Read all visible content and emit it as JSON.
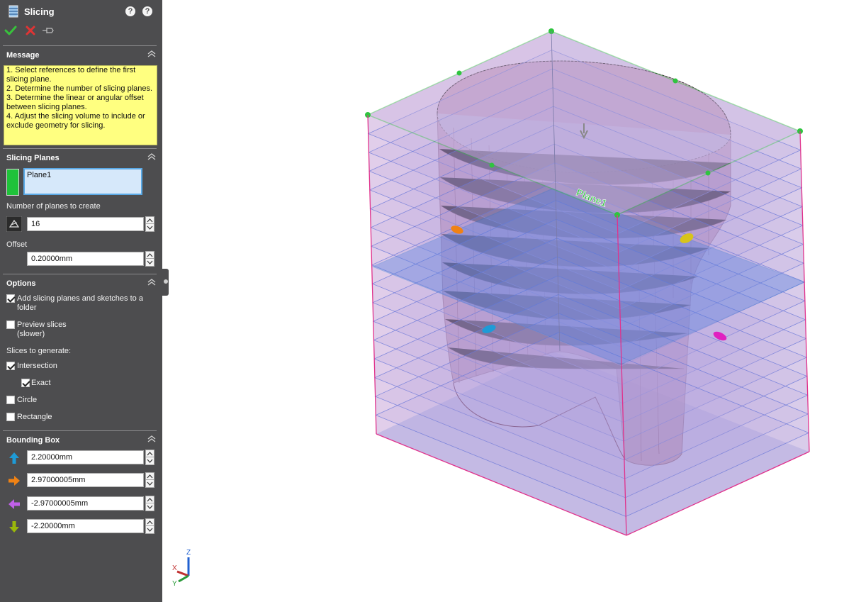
{
  "panel": {
    "title": "Slicing",
    "message": {
      "header": "Message",
      "lines": [
        "1. Select references to define the first slicing plane.",
        "2. Determine the number of slicing planes.",
        "3. Determine the linear or angular offset between slicing planes.",
        "4. Adjust the slicing volume to include or exclude geometry for slicing."
      ]
    },
    "slicing_planes": {
      "header": "Slicing Planes",
      "selected_item": "Plane1",
      "number_label": "Number of planes to create",
      "number_value": "16",
      "offset_label": "Offset",
      "offset_value": "0.20000mm"
    },
    "options": {
      "header": "Options",
      "add_to_folder": {
        "label": "Add slicing planes and sketches to a folder",
        "checked": true
      },
      "preview_slices": {
        "label": "Preview slices (slower)",
        "checked": false
      },
      "slices_label": "Slices to generate:",
      "intersection": {
        "label": "Intersection",
        "checked": true
      },
      "exact": {
        "label": "Exact",
        "checked": true
      },
      "circle": {
        "label": "Circle",
        "checked": false
      },
      "rectangle": {
        "label": "Rectangle",
        "checked": false
      }
    },
    "bounding_box": {
      "header": "Bounding Box",
      "up_value": "2.20000mm",
      "right_value": "2.97000005mm",
      "left_value": "-2.97000005mm",
      "down_value": "-2.20000mm"
    }
  },
  "viewport": {
    "plane_label": "Plane1",
    "triad": {
      "x": "X",
      "y": "Y",
      "z": "Z"
    }
  },
  "colors": {
    "panel_bg": "#4d4d4f",
    "message_bg": "#ffff80",
    "plane_swatch": "#1fc23a",
    "box_edge": "#e0328c",
    "plane_green": "#2fc43f",
    "plane_blue": "#2a76d2",
    "arrow_up": "#1e9bd7",
    "arrow_right": "#f08214",
    "arrow_left": "#c060e8",
    "arrow_down": "#9ab80a"
  },
  "icons": [
    "slicing-icon",
    "help-dynamic-icon",
    "help-icon",
    "ok-check-icon",
    "cancel-x-icon",
    "pin-icon",
    "collapse-chevron-icon",
    "planes-count-icon"
  ]
}
